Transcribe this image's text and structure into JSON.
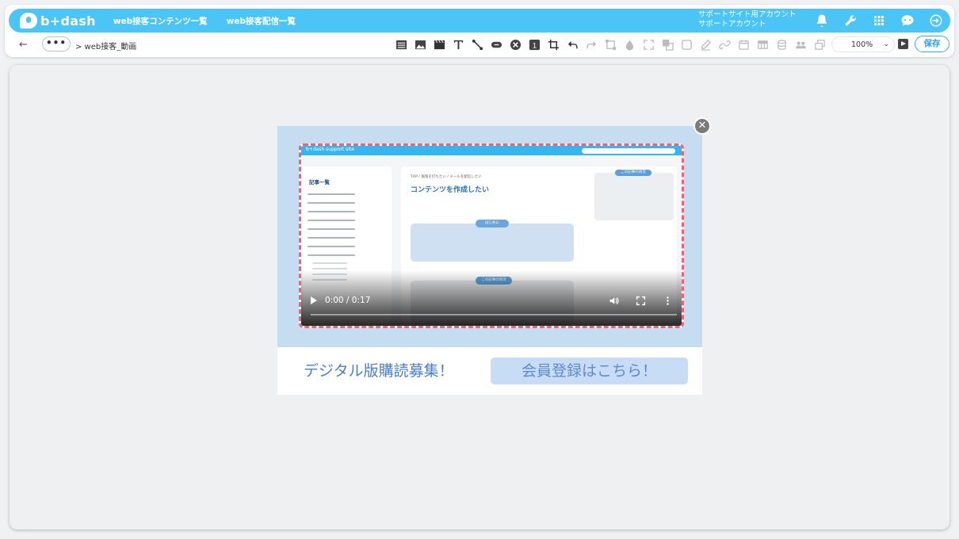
{
  "app": {
    "logo_text": "b+dash",
    "nav": [
      "web接客コンテンツ一覧",
      "web接客配信一覧"
    ],
    "account_line1": "サポートサイト用アカウント",
    "account_line2": "サポートアカウント",
    "top_icons": [
      "bell-icon",
      "wrench-icon",
      "grid-icon",
      "chat-bot-icon",
      "logout-icon"
    ]
  },
  "toolbar": {
    "back_symbol": "←",
    "more_symbol": "•••",
    "breadcrumb": "> web接客_動画",
    "zoom": "100%",
    "save_label": "保存"
  },
  "popup": {
    "close_symbol": "✕",
    "video": {
      "time": "0:00 / 0:17",
      "progress": 0,
      "inner_page": {
        "header_logo": "b+dash support site",
        "sidebar_title": "記事一覧",
        "crumb": "TOP / 施策を打ちたい / メールを配信したい",
        "title": "コンテンツを作成したい",
        "toc_heading": "この記事の目次",
        "intro_heading": "はじめに",
        "toc2_heading": "この記事の目次"
      }
    },
    "cta_text": "デジタル版購読募集！",
    "cta_button": "会員登録はこちら！"
  },
  "colors": {
    "brand": "#4bc5f5",
    "save_border": "#3aaee8",
    "dashed_border": "#e8657a",
    "popup_bg": "#c6dcf1",
    "cta_text": "#4a7ecb",
    "cta_button_bg": "#c8dcf5"
  }
}
